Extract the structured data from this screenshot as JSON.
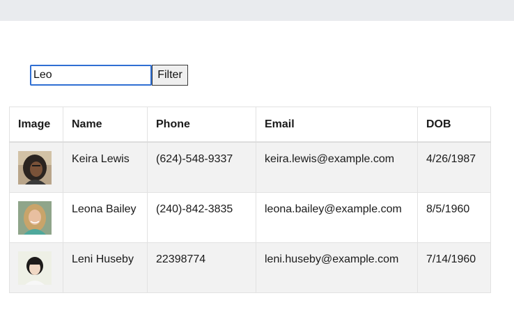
{
  "filter": {
    "input_value": "Leo",
    "button_label": "Filter"
  },
  "table": {
    "headers": [
      "Image",
      "Name",
      "Phone",
      "Email",
      "DOB"
    ],
    "rows": [
      {
        "name": "Keira Lewis",
        "phone": "(624)-548-9337",
        "email": "keira.lewis@example.com",
        "dob": "4/26/1987",
        "avatar": "photo-woman-curly-dark-hair-icon"
      },
      {
        "name": "Leona Bailey",
        "phone": "(240)-842-3835",
        "email": "leona.bailey@example.com",
        "dob": "8/5/1960",
        "avatar": "photo-woman-blonde-hair-icon"
      },
      {
        "name": "Leni Huseby",
        "phone": "22398774",
        "email": "leni.huseby@example.com",
        "dob": "7/14/1960",
        "avatar": "photo-woman-dark-short-hair-icon"
      }
    ]
  }
}
